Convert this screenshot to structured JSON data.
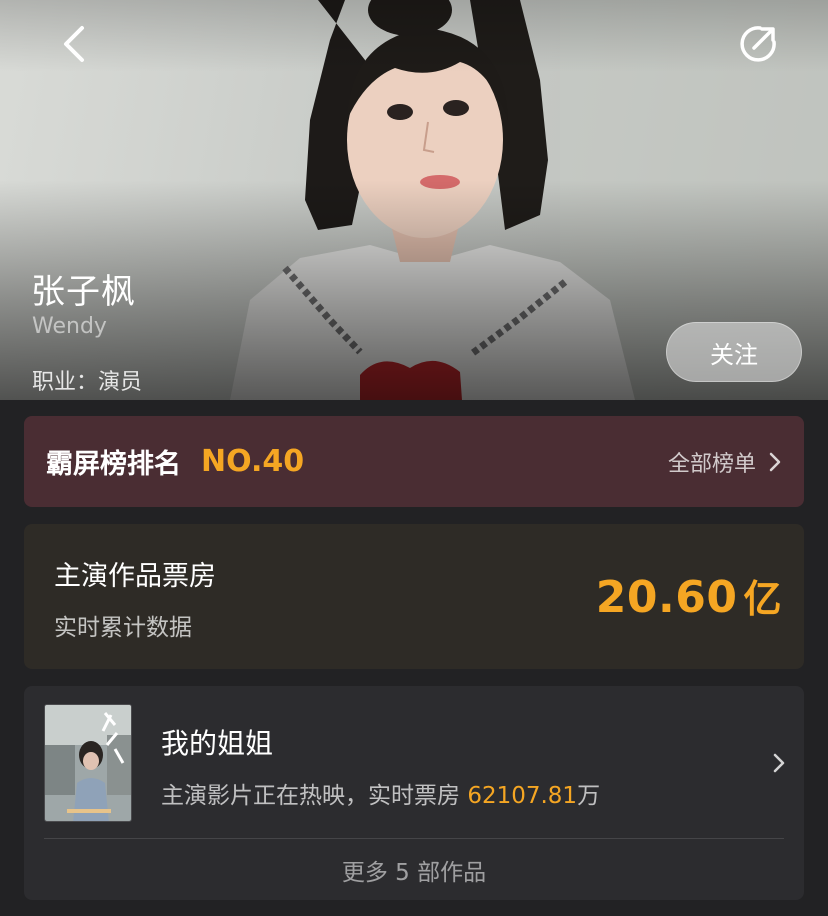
{
  "hero": {
    "name": "张子枫",
    "english_name": "Wendy",
    "occupation": "职业：演员",
    "follow_label": "关注",
    "back_icon": "back-arrow-icon",
    "share_icon": "share-icon"
  },
  "rank": {
    "label": "霸屏榜排名",
    "value": "NO.40",
    "link_label": "全部榜单"
  },
  "box_office": {
    "title": "主演作品票房",
    "subtitle": "实时累计数据",
    "value": "20.60",
    "unit": "亿"
  },
  "works": {
    "items": [
      {
        "title": "我的姐姐",
        "desc_prefix": "主演影片正在热映，实时票房 ",
        "desc_value": "62107.81",
        "desc_unit": "万"
      }
    ],
    "more_label": "更多 5 部作品"
  },
  "colors": {
    "accent": "#f5a623",
    "rank_bg": "#4a2d33",
    "box_bg": "#2e2b26",
    "card_bg": "#2c2c2f",
    "page_bg": "#222224"
  }
}
